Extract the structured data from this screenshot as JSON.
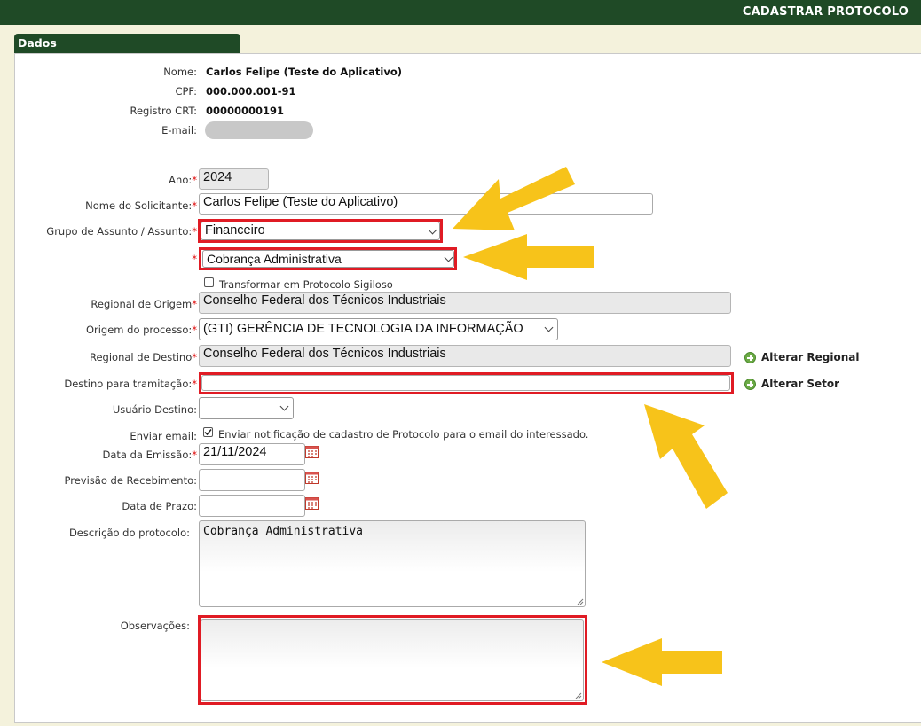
{
  "header": {
    "title": "CADASTRAR PROTOCOLO"
  },
  "tab": {
    "label": "Dados"
  },
  "profile": {
    "name_label": "Nome:",
    "name_value": "Carlos Felipe (Teste do Aplicativo)",
    "cpf_label": "CPF:",
    "cpf_value": "000.000.001-91",
    "crt_label": "Registro CRT:",
    "crt_value": "00000000191",
    "email_label": "E-mail:"
  },
  "form": {
    "required_mark": "*",
    "ano_label": "Ano:",
    "ano_value": "2024",
    "solicitante_label": "Nome do Solicitante:",
    "solicitante_value": "Carlos Felipe (Teste do Aplicativo)",
    "grupo_label": "Grupo de Assunto / Assunto:",
    "grupo_value": "Financeiro",
    "assunto_value": "Cobrança Administrativa",
    "sigiloso_label": "Transformar em Protocolo Sigiloso",
    "regional_origem_label": "Regional de Origem",
    "regional_origem_value": "Conselho Federal  dos Técnicos Industriais",
    "origem_processo_label": "Origem do processo:",
    "origem_processo_value": "(GTI) GERÊNCIA DE TECNOLOGIA DA INFORMAÇÃO",
    "regional_destino_label": "Regional de Destino",
    "regional_destino_value": "Conselho Federal  dos Técnicos Industriais",
    "alterar_regional": "Alterar Regional",
    "destino_label": "Destino para tramitação:",
    "destino_value": "",
    "alterar_setor": "Alterar Setor",
    "usuario_destino_label": "Usuário Destino:",
    "usuario_destino_value": "",
    "enviar_email_label": "Enviar email:",
    "enviar_email_text": "Enviar notificação de cadastro de Protocolo para o email do interessado.",
    "data_emissao_label": "Data da Emissão:",
    "data_emissao_value": "21/11/2024",
    "previsao_label": "Previsão de Recebimento:",
    "previsao_value": "",
    "prazo_label": "Data de Prazo:",
    "prazo_value": "",
    "descricao_label": "Descrição do protocolo:",
    "descricao_value": "Cobrança Administrativa",
    "observacoes_label": "Observações:",
    "observacoes_value": ""
  },
  "colors": {
    "header_green": "#1f4a26",
    "highlight_red": "#e01b24",
    "arrow_yellow": "#f7c31a"
  }
}
